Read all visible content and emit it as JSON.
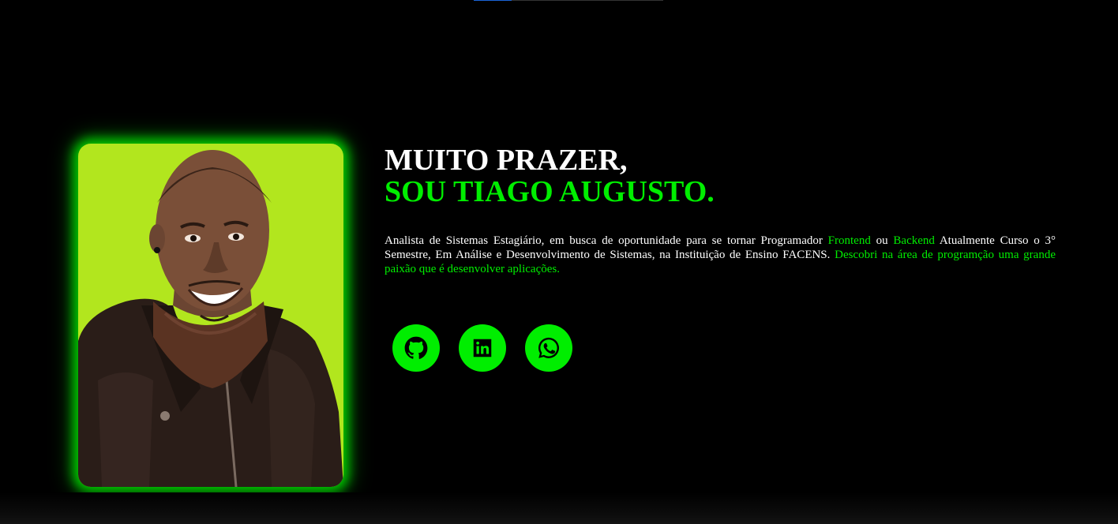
{
  "hero": {
    "greeting": "MUITO PRAZER,",
    "name": "SOU TIAGO AUGUSTO.",
    "bio": {
      "part1": "Analista de Sistemas Estagiário, em busca de oportunidade para se tornar Programador ",
      "frontend": "Frontend",
      "ou": " ou ",
      "backend": "Backend",
      "part2": " Atualmente Curso o 3° Semestre, Em Análise e Desenvolvimento de Sistemas, na Instituição de Ensino FACENS. ",
      "highlight": "Descobri na área de programção uma grande paixão que é desenvolver aplicações."
    }
  },
  "socials": [
    {
      "icon": "github-icon"
    },
    {
      "icon": "linkedin-icon"
    },
    {
      "icon": "whatsapp-icon"
    }
  ],
  "colors": {
    "accent": "#00ee00",
    "photo_background": "#b2e61e",
    "background": "#000000"
  }
}
